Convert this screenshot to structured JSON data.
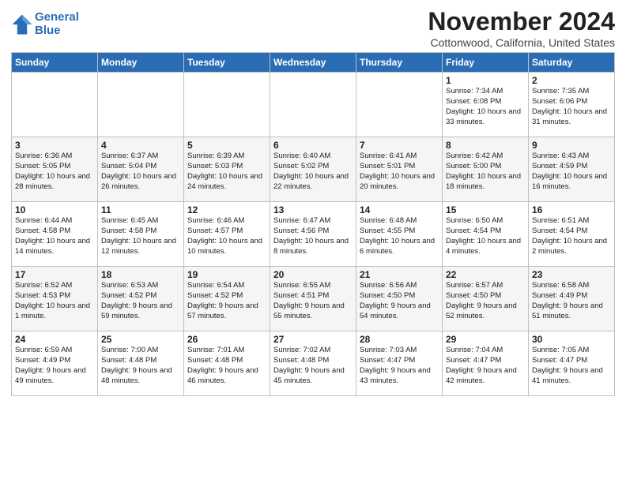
{
  "logo": {
    "line1": "General",
    "line2": "Blue"
  },
  "title": "November 2024",
  "location": "Cottonwood, California, United States",
  "days_of_week": [
    "Sunday",
    "Monday",
    "Tuesday",
    "Wednesday",
    "Thursday",
    "Friday",
    "Saturday"
  ],
  "weeks": [
    [
      {
        "day": "",
        "info": ""
      },
      {
        "day": "",
        "info": ""
      },
      {
        "day": "",
        "info": ""
      },
      {
        "day": "",
        "info": ""
      },
      {
        "day": "",
        "info": ""
      },
      {
        "day": "1",
        "info": "Sunrise: 7:34 AM\nSunset: 6:08 PM\nDaylight: 10 hours and 33 minutes."
      },
      {
        "day": "2",
        "info": "Sunrise: 7:35 AM\nSunset: 6:06 PM\nDaylight: 10 hours and 31 minutes."
      }
    ],
    [
      {
        "day": "3",
        "info": "Sunrise: 6:36 AM\nSunset: 5:05 PM\nDaylight: 10 hours and 28 minutes."
      },
      {
        "day": "4",
        "info": "Sunrise: 6:37 AM\nSunset: 5:04 PM\nDaylight: 10 hours and 26 minutes."
      },
      {
        "day": "5",
        "info": "Sunrise: 6:39 AM\nSunset: 5:03 PM\nDaylight: 10 hours and 24 minutes."
      },
      {
        "day": "6",
        "info": "Sunrise: 6:40 AM\nSunset: 5:02 PM\nDaylight: 10 hours and 22 minutes."
      },
      {
        "day": "7",
        "info": "Sunrise: 6:41 AM\nSunset: 5:01 PM\nDaylight: 10 hours and 20 minutes."
      },
      {
        "day": "8",
        "info": "Sunrise: 6:42 AM\nSunset: 5:00 PM\nDaylight: 10 hours and 18 minutes."
      },
      {
        "day": "9",
        "info": "Sunrise: 6:43 AM\nSunset: 4:59 PM\nDaylight: 10 hours and 16 minutes."
      }
    ],
    [
      {
        "day": "10",
        "info": "Sunrise: 6:44 AM\nSunset: 4:58 PM\nDaylight: 10 hours and 14 minutes."
      },
      {
        "day": "11",
        "info": "Sunrise: 6:45 AM\nSunset: 4:58 PM\nDaylight: 10 hours and 12 minutes."
      },
      {
        "day": "12",
        "info": "Sunrise: 6:46 AM\nSunset: 4:57 PM\nDaylight: 10 hours and 10 minutes."
      },
      {
        "day": "13",
        "info": "Sunrise: 6:47 AM\nSunset: 4:56 PM\nDaylight: 10 hours and 8 minutes."
      },
      {
        "day": "14",
        "info": "Sunrise: 6:48 AM\nSunset: 4:55 PM\nDaylight: 10 hours and 6 minutes."
      },
      {
        "day": "15",
        "info": "Sunrise: 6:50 AM\nSunset: 4:54 PM\nDaylight: 10 hours and 4 minutes."
      },
      {
        "day": "16",
        "info": "Sunrise: 6:51 AM\nSunset: 4:54 PM\nDaylight: 10 hours and 2 minutes."
      }
    ],
    [
      {
        "day": "17",
        "info": "Sunrise: 6:52 AM\nSunset: 4:53 PM\nDaylight: 10 hours and 1 minute."
      },
      {
        "day": "18",
        "info": "Sunrise: 6:53 AM\nSunset: 4:52 PM\nDaylight: 9 hours and 59 minutes."
      },
      {
        "day": "19",
        "info": "Sunrise: 6:54 AM\nSunset: 4:52 PM\nDaylight: 9 hours and 57 minutes."
      },
      {
        "day": "20",
        "info": "Sunrise: 6:55 AM\nSunset: 4:51 PM\nDaylight: 9 hours and 55 minutes."
      },
      {
        "day": "21",
        "info": "Sunrise: 6:56 AM\nSunset: 4:50 PM\nDaylight: 9 hours and 54 minutes."
      },
      {
        "day": "22",
        "info": "Sunrise: 6:57 AM\nSunset: 4:50 PM\nDaylight: 9 hours and 52 minutes."
      },
      {
        "day": "23",
        "info": "Sunrise: 6:58 AM\nSunset: 4:49 PM\nDaylight: 9 hours and 51 minutes."
      }
    ],
    [
      {
        "day": "24",
        "info": "Sunrise: 6:59 AM\nSunset: 4:49 PM\nDaylight: 9 hours and 49 minutes."
      },
      {
        "day": "25",
        "info": "Sunrise: 7:00 AM\nSunset: 4:48 PM\nDaylight: 9 hours and 48 minutes."
      },
      {
        "day": "26",
        "info": "Sunrise: 7:01 AM\nSunset: 4:48 PM\nDaylight: 9 hours and 46 minutes."
      },
      {
        "day": "27",
        "info": "Sunrise: 7:02 AM\nSunset: 4:48 PM\nDaylight: 9 hours and 45 minutes."
      },
      {
        "day": "28",
        "info": "Sunrise: 7:03 AM\nSunset: 4:47 PM\nDaylight: 9 hours and 43 minutes."
      },
      {
        "day": "29",
        "info": "Sunrise: 7:04 AM\nSunset: 4:47 PM\nDaylight: 9 hours and 42 minutes."
      },
      {
        "day": "30",
        "info": "Sunrise: 7:05 AM\nSunset: 4:47 PM\nDaylight: 9 hours and 41 minutes."
      }
    ]
  ]
}
